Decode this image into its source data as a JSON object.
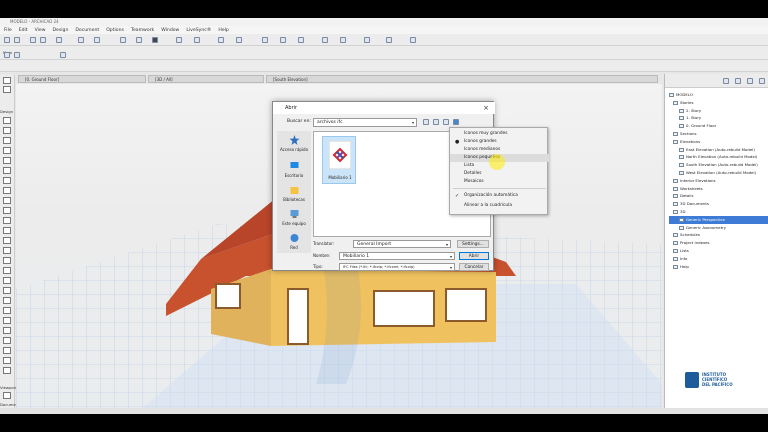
{
  "app": {
    "title": "MODELO - ARCHICAD 24"
  },
  "menubar": [
    "File",
    "Edit",
    "View",
    "Design",
    "Document",
    "Options",
    "Teamwork",
    "Window",
    "LiveSync®",
    "Help"
  ],
  "toolbox": {
    "main_label": "Main",
    "design_label": "Design",
    "viewpoint_label": "Viewpoint",
    "document_label": "Document"
  },
  "tabs": [
    {
      "label": "[0. Ground Floor]"
    },
    {
      "label": "[3D / All]"
    },
    {
      "label": "[South Elevation]"
    }
  ],
  "navigator": {
    "items": [
      {
        "label": "MODELO"
      },
      {
        "label": "Stories"
      },
      {
        "label": "2. Story"
      },
      {
        "label": "1. Story"
      },
      {
        "label": "0. Ground Floor"
      },
      {
        "label": "Sections"
      },
      {
        "label": "Elevations"
      },
      {
        "label": "East Elevation (Auto-rebuild Model)"
      },
      {
        "label": "North Elevation (Auto-rebuild Model)"
      },
      {
        "label": "South Elevation (Auto-rebuild Model)"
      },
      {
        "label": "West Elevation (Auto-rebuild Model)"
      },
      {
        "label": "Interior Elevations"
      },
      {
        "label": "Worksheets"
      },
      {
        "label": "Details"
      },
      {
        "label": "3D Documents"
      },
      {
        "label": "3D"
      },
      {
        "label": "Generic Perspective"
      },
      {
        "label": "Generic Axonometry"
      },
      {
        "label": "Schedules"
      },
      {
        "label": "Project Indexes"
      },
      {
        "label": "Lists"
      },
      {
        "label": "Info"
      },
      {
        "label": "Help"
      }
    ]
  },
  "watermark": {
    "line1": "INSTITUTO",
    "line2": "CIENTÍFICO",
    "line3": "DEL PACÍFICO"
  },
  "dialog": {
    "title": "Abrir",
    "look_in_label": "Buscar en:",
    "look_in_value": "archivos ifc",
    "places": [
      {
        "label": "Acceso rápido"
      },
      {
        "label": "Escritorio"
      },
      {
        "label": "Bibliotecas"
      },
      {
        "label": "Este equipo"
      },
      {
        "label": "Red"
      }
    ],
    "file": {
      "name": "Mobiliario 1"
    },
    "translator_label": "Translator:",
    "translator_value": "General Import",
    "settings_button": "Settings...",
    "name_label": "Nombre:",
    "name_value": "Mobiliario 1",
    "type_label": "Tipo:",
    "type_value": "IFC Files (*.ifc; *.ifczip; *.ifcxml; *.ifcxip)",
    "open_button": "Abrir",
    "cancel_button": "Cancelar"
  },
  "view_menu": {
    "items": [
      {
        "label": "Iconos muy grandes",
        "mark": ""
      },
      {
        "label": "Iconos grandes",
        "mark": "●"
      },
      {
        "label": "Iconos medianos",
        "mark": ""
      },
      {
        "label": "Iconos pequeños",
        "mark": ""
      },
      {
        "label": "Lista",
        "mark": ""
      },
      {
        "label": "Detalles",
        "mark": ""
      },
      {
        "label": "Mosaicos",
        "mark": ""
      },
      {
        "label": "Organización automática",
        "mark": "✓"
      },
      {
        "label": "Alinear a la cuadrícula",
        "mark": ""
      }
    ]
  }
}
